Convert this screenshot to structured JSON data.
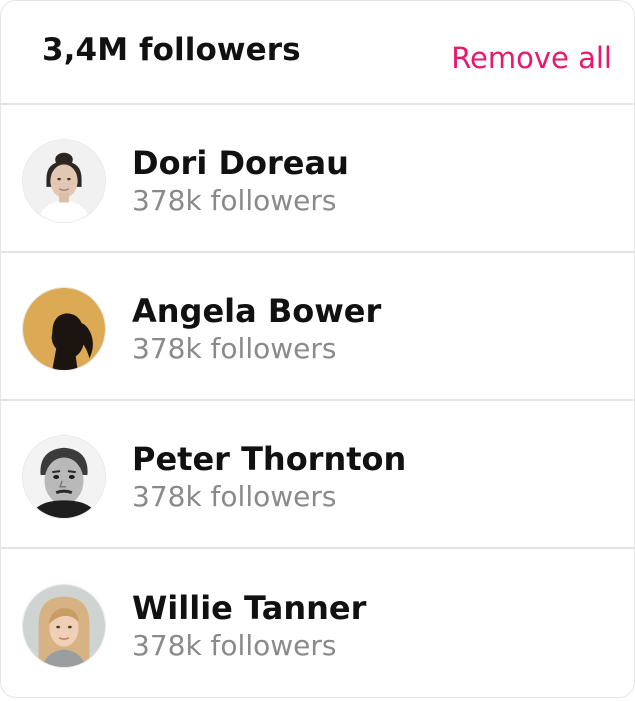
{
  "header": {
    "title": "3,4M followers",
    "remove_all_label": "Remove all"
  },
  "colors": {
    "accent": "#e8186d",
    "divider": "#e3e3e3",
    "secondary_text": "#8a8a8a"
  },
  "users": [
    {
      "name": "Dori Doreau",
      "followers": "378k followers",
      "avatar": "avatar-photo-dori"
    },
    {
      "name": "Angela Bower",
      "followers": "378k followers",
      "avatar": "avatar-photo-angela"
    },
    {
      "name": "Peter Thornton",
      "followers": "378k followers",
      "avatar": "avatar-photo-peter"
    },
    {
      "name": "Willie Tanner",
      "followers": "378k followers",
      "avatar": "avatar-photo-willie"
    }
  ]
}
